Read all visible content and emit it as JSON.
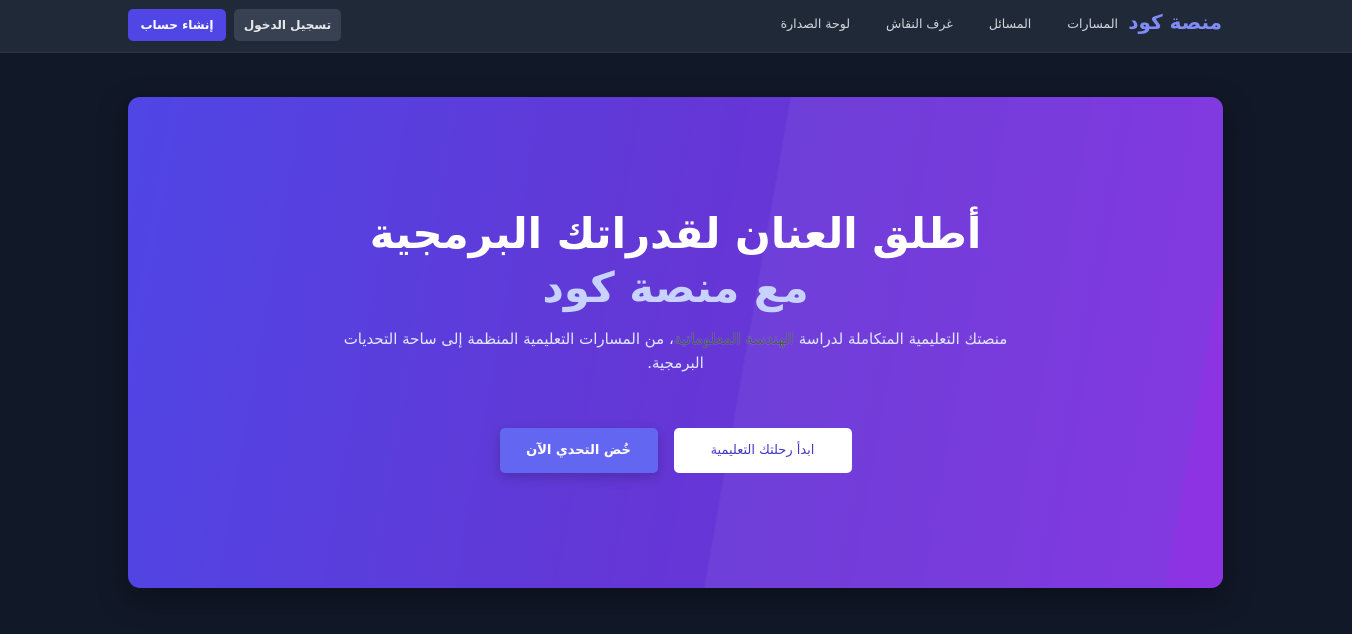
{
  "brand": {
    "name": "منصة كود"
  },
  "nav": {
    "items": [
      {
        "label": "المسارات"
      },
      {
        "label": "المسائل"
      },
      {
        "label": "غرف النقاش"
      },
      {
        "label": "لوحة الصدارة"
      }
    ]
  },
  "auth": {
    "login_label": "تسجيل الدخول",
    "signup_label": "إنشاء حساب"
  },
  "hero": {
    "title_line1": "أطلق العنان لقدراتك البرمجية",
    "title_line2": "مع منصة كود",
    "desc_part1": "منصتك التعليمية المتكاملة لدراسة ",
    "desc_highlight": "الهندسة المعلوماتية",
    "desc_part2": "، من المسارات التعليمية المنظمة إلى ساحة التحديات البرمجية.",
    "start_label": "ابدأ رحلتك التعليمية",
    "challenge_label": "خُض التحدي الآن"
  },
  "colors": {
    "accent": "#4f46e5",
    "brand": "#818cf8",
    "background": "#111827",
    "navbar": "#1f2937"
  }
}
